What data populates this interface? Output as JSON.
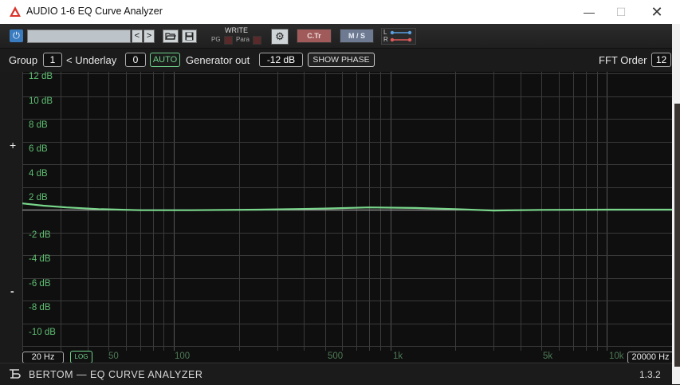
{
  "window": {
    "title": "AUDIO 1-6 EQ Curve Analyzer",
    "minimize_glyph": "—",
    "maximize_glyph": "☐",
    "close_glyph": "✕"
  },
  "toolbar": {
    "power_icon": "power-icon",
    "preset_value": "",
    "prev_glyph": "<",
    "next_glyph": ">",
    "open_icon": "folder-open-icon",
    "save_icon": "floppy-disk-icon",
    "write_label": "WRITE",
    "pg_label": "PG",
    "para_label": "Para",
    "settings_icon": "gear-icon",
    "ctr_label": "C.Tr",
    "ms_label": "M / S",
    "lr_left": "L",
    "lr_right": "R"
  },
  "controls": {
    "group_label": "Group",
    "group_value": "1",
    "underlay_label": "< Underlay",
    "underlay_value": "0",
    "auto_label": "AUTO",
    "generator_label": "Generator out",
    "generator_value": "-12 dB",
    "show_phase_label": "SHOW PHASE",
    "fft_label": "FFT Order",
    "fft_value": "12"
  },
  "graph": {
    "plus_label": "+",
    "minus_label": "-",
    "db_labels": [
      "12 dB",
      "10 dB",
      "8 dB",
      "6 dB",
      "4 dB",
      "2 dB",
      "-2 dB",
      "-4 dB",
      "-6 dB",
      "-8 dB",
      "-10 dB"
    ],
    "freq_labels": [
      "50",
      "100",
      "500",
      "1k",
      "5k",
      "10k"
    ],
    "freq_min": "20 Hz",
    "freq_max": "20000 Hz",
    "log_label": "LOG",
    "db_range": [
      -12,
      12
    ],
    "x_range_hz": [
      20,
      20000
    ],
    "x_scale": "log",
    "grid": true,
    "curve_color": "#79d68b",
    "curve": [
      {
        "hz": 20,
        "db": 0.55
      },
      {
        "hz": 25,
        "db": 0.35
      },
      {
        "hz": 32,
        "db": 0.2
      },
      {
        "hz": 45,
        "db": 0.05
      },
      {
        "hz": 70,
        "db": -0.05
      },
      {
        "hz": 120,
        "db": -0.05
      },
      {
        "hz": 250,
        "db": 0.0
      },
      {
        "hz": 500,
        "db": 0.1
      },
      {
        "hz": 800,
        "db": 0.2
      },
      {
        "hz": 1300,
        "db": 0.15
      },
      {
        "hz": 2000,
        "db": 0.05
      },
      {
        "hz": 3000,
        "db": -0.08
      },
      {
        "hz": 5000,
        "db": -0.02
      },
      {
        "hz": 10000,
        "db": 0.0
      },
      {
        "hz": 20000,
        "db": 0.0
      }
    ]
  },
  "footer": {
    "brand": "BERTOM — EQ CURVE ANALYZER",
    "version": "1.3.2",
    "logo_icon": "bertom-logo-icon"
  },
  "colors": {
    "accent_green": "#6ed28a",
    "db_label_green": "#5fbf72",
    "freq_label_green": "#4d7a55",
    "ctr_red": "#a05a5a",
    "ms_blue": "#6d7a91",
    "power_blue": "#3a7cc0"
  }
}
